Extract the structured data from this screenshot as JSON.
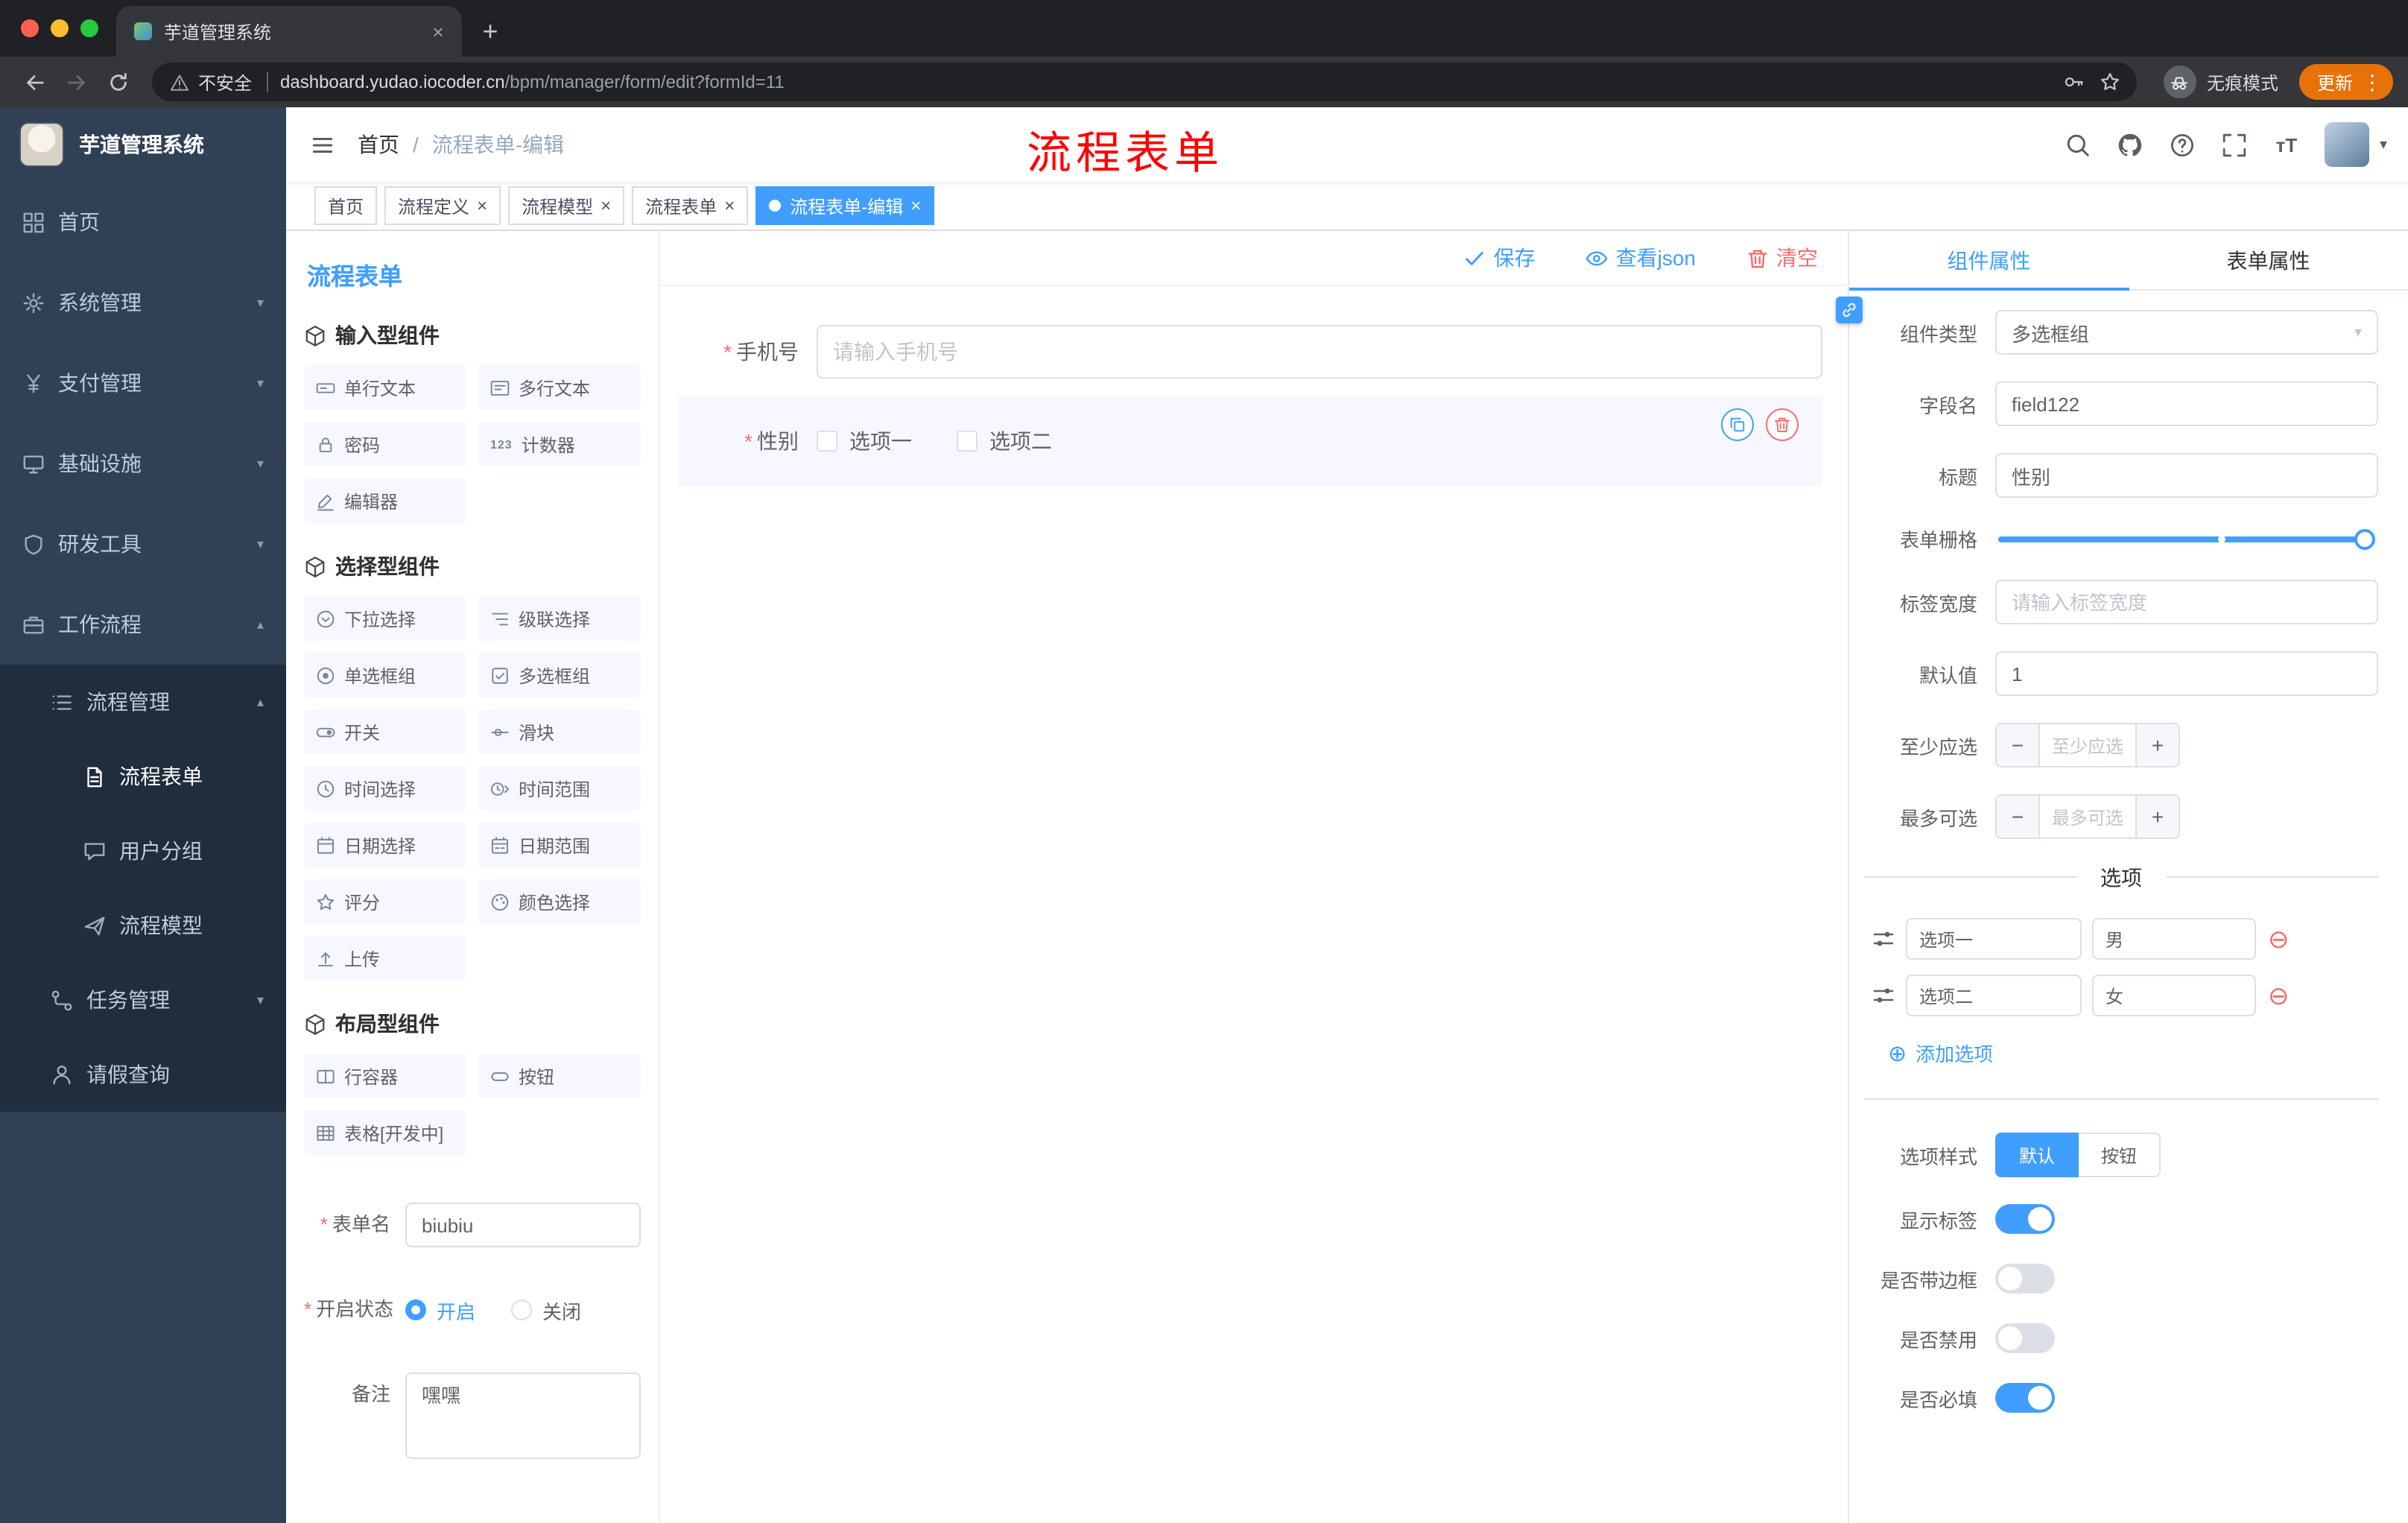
{
  "browser": {
    "tab_title": "芋道管理系统",
    "security_label": "不安全",
    "url_domain": "dashboard.yudao.iocoder.cn",
    "url_path": "/bpm/manager/form/edit?formId=11",
    "incognito_label": "无痕模式",
    "update_label": "更新"
  },
  "ui": {
    "required_marker": "*",
    "breadcrumb_separator": "/"
  },
  "sidebar": {
    "logo_title": "芋道管理系统",
    "items": [
      {
        "label": "首页",
        "icon": "dashboard-icon"
      },
      {
        "label": "系统管理",
        "icon": "gear-icon"
      },
      {
        "label": "支付管理",
        "icon": "payment-icon"
      },
      {
        "label": "基础设施",
        "icon": "infrastructure-icon"
      },
      {
        "label": "研发工具",
        "icon": "devtools-icon"
      },
      {
        "label": "工作流程",
        "icon": "workflow-icon",
        "expanded": true
      }
    ],
    "workflow_menu": {
      "process_management": {
        "label": "流程管理",
        "icon": "process-list-icon",
        "expanded": true,
        "children": [
          {
            "label": "流程表单",
            "icon": "form-doc-icon",
            "active": true
          },
          {
            "label": "用户分组",
            "icon": "user-group-icon"
          },
          {
            "label": "流程模型",
            "icon": "process-model-icon"
          }
        ]
      },
      "task_management": {
        "label": "任务管理",
        "icon": "task-tree-icon"
      },
      "leave_query": {
        "label": "请假查询",
        "icon": "person-icon"
      }
    }
  },
  "header": {
    "breadcrumb": {
      "home": "首页",
      "current": "流程表单-编辑"
    },
    "annotation": "流程表单"
  },
  "tags": {
    "items": [
      {
        "label": "首页",
        "closable": false,
        "active": false
      },
      {
        "label": "流程定义",
        "closable": true,
        "active": false
      },
      {
        "label": "流程模型",
        "closable": true,
        "active": false
      },
      {
        "label": "流程表单",
        "closable": true,
        "active": false
      },
      {
        "label": "流程表单-编辑",
        "closable": true,
        "active": true
      }
    ]
  },
  "builder": {
    "panel_title": "流程表单",
    "groups": [
      {
        "title": "输入型组件",
        "items": [
          {
            "label": "单行文本",
            "icon": "single-line-input-icon"
          },
          {
            "label": "多行文本",
            "icon": "textarea-icon"
          },
          {
            "label": "密码",
            "icon": "password-icon"
          },
          {
            "label": "计数器",
            "icon": "counter-icon"
          },
          {
            "label": "编辑器",
            "icon": "editor-icon"
          }
        ]
      },
      {
        "title": "选择型组件",
        "items": [
          {
            "label": "下拉选择",
            "icon": "select-icon"
          },
          {
            "label": "级联选择",
            "icon": "cascader-icon"
          },
          {
            "label": "单选框组",
            "icon": "radio-group-icon"
          },
          {
            "label": "多选框组",
            "icon": "checkbox-group-icon"
          },
          {
            "label": "开关",
            "icon": "switch-icon"
          },
          {
            "label": "滑块",
            "icon": "slider-icon"
          },
          {
            "label": "时间选择",
            "icon": "time-picker-icon"
          },
          {
            "label": "时间范围",
            "icon": "time-range-icon"
          },
          {
            "label": "日期选择",
            "icon": "date-picker-icon"
          },
          {
            "label": "日期范围",
            "icon": "date-range-icon"
          },
          {
            "label": "评分",
            "icon": "rate-icon"
          },
          {
            "label": "颜色选择",
            "icon": "color-picker-icon"
          },
          {
            "label": "上传",
            "icon": "upload-icon"
          }
        ]
      },
      {
        "title": "布局型组件",
        "items": [
          {
            "label": "行容器",
            "icon": "row-container-icon"
          },
          {
            "label": "按钮",
            "icon": "button-icon"
          },
          {
            "label": "表格[开发中]",
            "icon": "table-icon"
          }
        ]
      }
    ],
    "form": {
      "name_label": "表单名",
      "name_value": "biubiu",
      "status_label": "开启状态",
      "status_on": "开启",
      "status_off": "关闭",
      "remark_label": "备注",
      "remark_value": "嘿嘿"
    }
  },
  "toolbar": {
    "save_label": "保存",
    "view_json_label": "查看json",
    "clear_label": "清空"
  },
  "canvas": {
    "phone": {
      "label": "手机号",
      "placeholder": "请输入手机号"
    },
    "gender": {
      "label": "性别",
      "options": [
        {
          "label": "选项一"
        },
        {
          "label": "选项二"
        }
      ]
    }
  },
  "inspector": {
    "tabs": [
      {
        "label": "组件属性",
        "active": true
      },
      {
        "label": "表单属性",
        "active": false
      }
    ],
    "component_type": {
      "label": "组件类型",
      "value": "多选框组"
    },
    "field_name": {
      "label": "字段名",
      "value": "field122"
    },
    "title": {
      "label": "标题",
      "value": "性别"
    },
    "grid": {
      "label": "表单栅格"
    },
    "label_width": {
      "label": "标签宽度",
      "placeholder": "请输入标签宽度"
    },
    "default_value": {
      "label": "默认值",
      "value": "1"
    },
    "min_select": {
      "label": "至少应选",
      "placeholder": "至少应选"
    },
    "max_select": {
      "label": "最多可选",
      "placeholder": "最多可选"
    },
    "options_title": "选项",
    "options": [
      {
        "label": "选项一",
        "value": "男"
      },
      {
        "label": "选项二",
        "value": "女"
      }
    ],
    "add_option_label": "添加选项",
    "option_style": {
      "label": "选项样式",
      "choices": [
        {
          "label": "默认",
          "active": true
        },
        {
          "label": "按钮",
          "active": false
        }
      ]
    },
    "switches": [
      {
        "label": "显示标签",
        "on": true
      },
      {
        "label": "是否带边框",
        "on": false
      },
      {
        "label": "是否禁用",
        "on": false
      },
      {
        "label": "是否必填",
        "on": true
      }
    ]
  }
}
